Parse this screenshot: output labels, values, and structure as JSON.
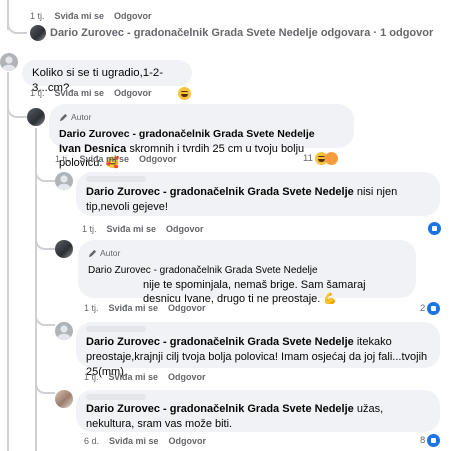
{
  "top": {
    "time": "1 tj.",
    "like": "Sviđa mi se",
    "reply": "Odgovor"
  },
  "reply_summary": {
    "text": "Dario Zurovec - gradonačelnik Grada Svete Nedelje odgovara · 1 odgovor"
  },
  "comments": [
    {
      "text": "Koliko si se ti ugradio,1-2-3...cm?",
      "time": "1 tj.",
      "like": "Sviđa mi se",
      "reply": "Odgovor",
      "reaction_icon": "laugh-emoji"
    },
    {
      "author_badge": "Autor",
      "author": "Dario Zurovec - gradonačelnik Grada Svete Nedelje",
      "mention": "Ivan Desnica",
      "text": "skromnih i tvrdih 25 cm u tvoju bolju polovicu. 🥰",
      "time": "1 tj.",
      "like": "Sviđa mi se",
      "reply": "Odgovor",
      "reaction_count": "11",
      "reaction_icons": [
        "laugh-emoji",
        "angry-emoji"
      ]
    },
    {
      "mention": "Dario Zurovec - gradonačelnik Grada Svete Nedelje",
      "text": "nisi njen tip,nevoli gejeve!",
      "time": "1 tj.",
      "like": "Sviđa mi se",
      "reply": "Odgovor",
      "reaction_icon": "like-emoji"
    },
    {
      "author_badge": "Autor",
      "author": "Dario Zurovec - gradonačelnik Grada Svete Nedelje",
      "text": "nije te spominjala, nemaš brige. Sam šamaraj desnicu Ivane, drugo ti ne preostaje. 💪",
      "time": "1 tj.",
      "like": "Sviđa mi se",
      "reply": "Odgovor",
      "reaction_count": "2",
      "reaction_icon": "like-emoji"
    },
    {
      "mention": "Dario Zurovec - gradonačelnik Grada Svete Nedelje",
      "text": "itekako preostaje,krajnji cilj tvoja bolja polovica! Imam osjećaj da joj fali...tvojih 25(mm)",
      "time": "1 tj.",
      "like": "Sviđa mi se",
      "reply": "Odgovor"
    },
    {
      "mention": "Dario Zurovec - gradonačelnik Grada Svete Nedelje",
      "text": "užas, nekultura, sram vas može biti.",
      "time": "6 d.",
      "like": "Sviđa mi se",
      "reply": "Odgovor",
      "reaction_count": "8",
      "reaction_icon": "like-emoji"
    }
  ],
  "colors": {
    "bubble": "#f0f2f5",
    "meta_text": "#65676b",
    "like_blue": "#1b74e4",
    "thread_line": "#ced0d4"
  }
}
